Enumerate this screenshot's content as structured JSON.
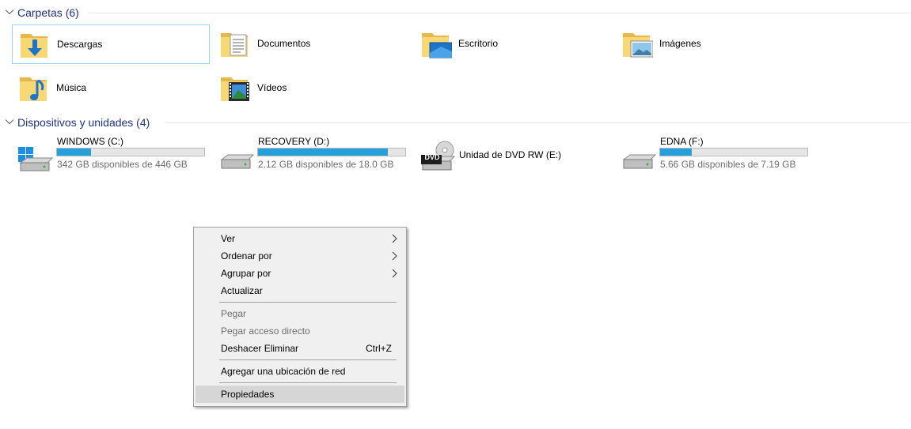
{
  "groups": {
    "folders": {
      "title": "Carpetas (6)"
    },
    "drives": {
      "title": "Dispositivos y unidades (4)"
    }
  },
  "folders": [
    {
      "label": "Descargas",
      "icon": "downloads-folder-icon",
      "selected": true
    },
    {
      "label": "Documentos",
      "icon": "documents-folder-icon"
    },
    {
      "label": "Escritorio",
      "icon": "desktop-folder-icon"
    },
    {
      "label": "Imágenes",
      "icon": "pictures-folder-icon"
    },
    {
      "label": "Música",
      "icon": "music-folder-icon"
    },
    {
      "label": "Vídeos",
      "icon": "videos-folder-icon"
    }
  ],
  "drives": [
    {
      "name": "WINDOWS (C:)",
      "free": "342 GB disponibles de 446 GB",
      "used_fraction": 0.233,
      "icon": "windows-drive-icon"
    },
    {
      "name": "RECOVERY (D:)",
      "free": "2.12 GB disponibles de 18.0 GB",
      "used_fraction": 0.882,
      "icon": "hard-drive-icon"
    },
    {
      "name": "Unidad de DVD RW (E:)",
      "icon": "dvd-drive-icon",
      "badge": "DVD"
    },
    {
      "name": "EDNA (F:)",
      "free": "5.66 GB disponibles de 7.19 GB",
      "used_fraction": 0.213,
      "icon": "hard-drive-icon"
    }
  ],
  "context_menu": {
    "items": [
      {
        "label": "Ver",
        "submenu": true
      },
      {
        "label": "Ordenar por",
        "submenu": true
      },
      {
        "label": "Agrupar por",
        "submenu": true
      },
      {
        "label": "Actualizar"
      },
      {
        "label": "Pegar",
        "disabled": true
      },
      {
        "label": "Pegar acceso directo",
        "disabled": true
      },
      {
        "label": "Deshacer Eliminar",
        "shortcut": "Ctrl+Z"
      },
      {
        "label": "Agregar una ubicación de red"
      },
      {
        "label": "Propiedades",
        "highlighted": true
      }
    ]
  },
  "colors": {
    "group_title": "#1e3287",
    "usage_bar": "#26a0da",
    "selection_border": "#99d1ff",
    "folder": "#f8d775"
  }
}
